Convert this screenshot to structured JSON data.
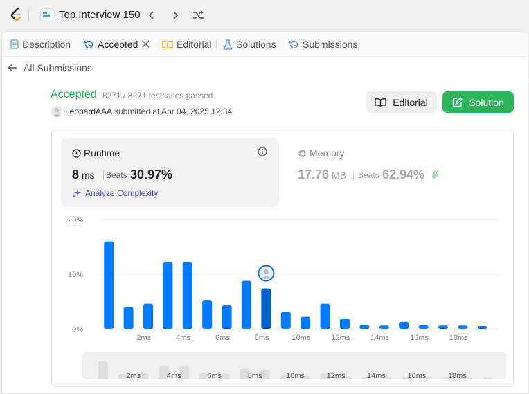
{
  "topbar": {
    "list_title": "Top Interview 150"
  },
  "tabs": [
    {
      "label": "Description",
      "icon": "description-icon"
    },
    {
      "label": "Accepted",
      "icon": "history-icon"
    },
    {
      "label": "Editorial",
      "icon": "book-icon"
    },
    {
      "label": "Solutions",
      "icon": "flask-icon"
    },
    {
      "label": "Submissions",
      "icon": "history-icon"
    }
  ],
  "subbar": {
    "back_label": "All Submissions"
  },
  "result": {
    "status": "Accepted",
    "cases": "8271 / 8271 testcases passed",
    "user": "LeopardAAA",
    "submitted": "submitted at Apr 04, 2025 12:34"
  },
  "buttons": {
    "editorial": "Editorial",
    "solution": "Solution"
  },
  "runtime": {
    "label": "Runtime",
    "value": "8",
    "unit": "ms",
    "beats_label": "Beats",
    "beats_value": "30.97%",
    "analyze": "Analyze Complexity"
  },
  "memory": {
    "label": "Memory",
    "value": "17.76",
    "unit": "MB",
    "beats_label": "Beats",
    "beats_value": "62.94%"
  },
  "colors": {
    "accepted": "#2db55d",
    "bar": "#007aff",
    "bar_highlight": "#0062cc",
    "analyze": "#5a4ee0"
  },
  "chart_data": {
    "type": "bar",
    "ylim": [
      0,
      20
    ],
    "y_ticks": [
      "0%",
      "10%",
      "20%"
    ],
    "x_ticks": [
      "2ms",
      "4ms",
      "6ms",
      "8ms",
      "10ms",
      "12ms",
      "14ms",
      "16ms",
      "18ms"
    ],
    "values": [
      16,
      4,
      4.6,
      12.2,
      12.2,
      5.3,
      4.3,
      8.8,
      7.4,
      3.1,
      2.2,
      4.6,
      1.9,
      0.7,
      0.6,
      1.3,
      0.7,
      0.6,
      0.6,
      0.5
    ],
    "highlight_index": 8,
    "grid": true
  }
}
